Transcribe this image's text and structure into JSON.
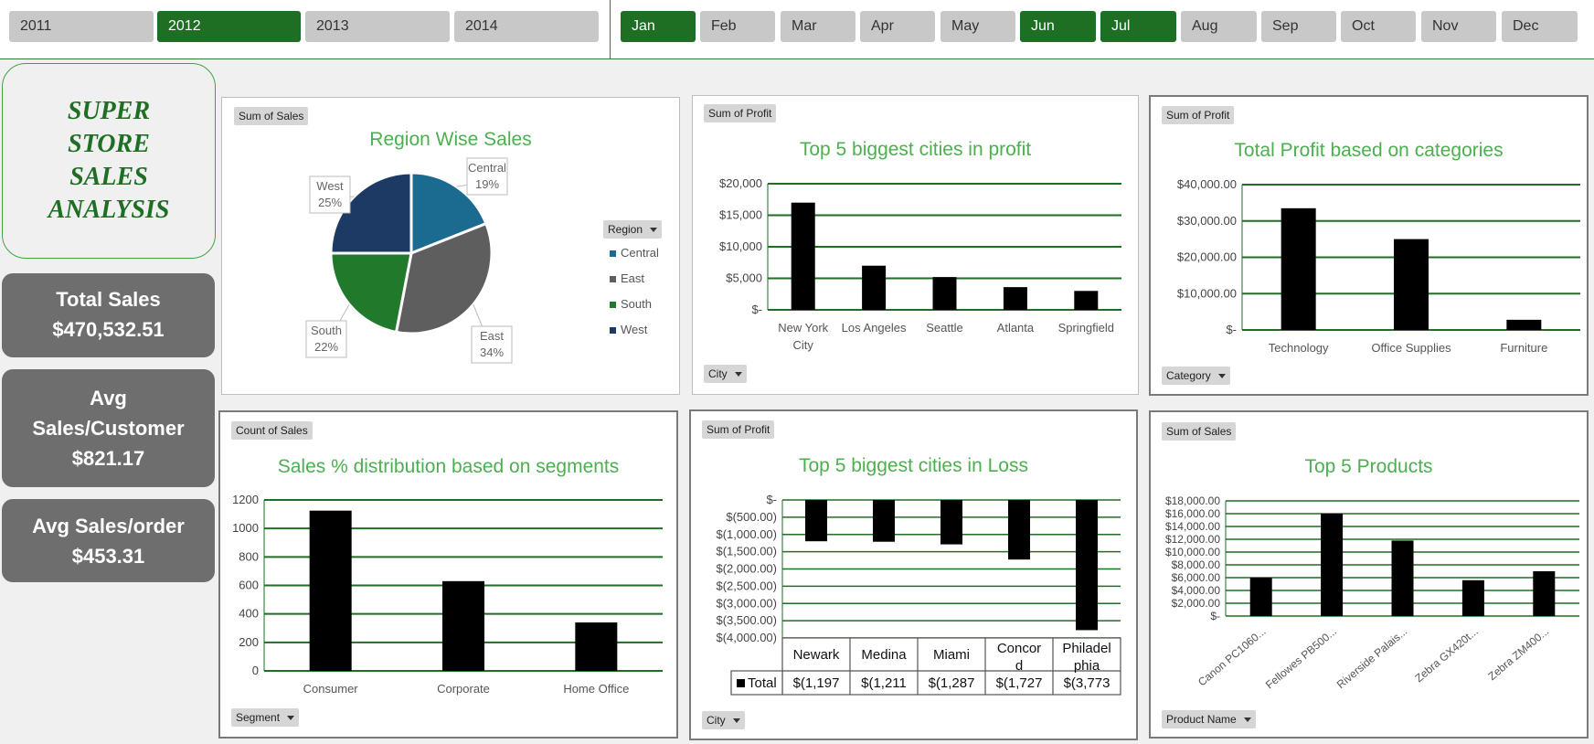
{
  "years": {
    "items": [
      {
        "label": "2011",
        "selected": false
      },
      {
        "label": "2012",
        "selected": true
      },
      {
        "label": "2013",
        "selected": false
      },
      {
        "label": "2014",
        "selected": false
      }
    ]
  },
  "months": {
    "items": [
      {
        "label": "Jan",
        "selected": true
      },
      {
        "label": "Feb",
        "selected": false
      },
      {
        "label": "Mar",
        "selected": false
      },
      {
        "label": "Apr",
        "selected": false
      },
      {
        "label": "May",
        "selected": false
      },
      {
        "label": "Jun",
        "selected": true
      },
      {
        "label": "Jul",
        "selected": true
      },
      {
        "label": "Aug",
        "selected": false
      },
      {
        "label": "Sep",
        "selected": false
      },
      {
        "label": "Oct",
        "selected": false
      },
      {
        "label": "Nov",
        "selected": false
      },
      {
        "label": "Dec",
        "selected": false
      }
    ]
  },
  "dashboard_title": "SUPER\nSTORE\nSALES\nANALYSIS",
  "kpis": {
    "total_sales": {
      "label": "Total Sales",
      "value": "$470,532.51"
    },
    "avg_sales_customer": {
      "label": "Avg\nSales/Customer",
      "value": "$821.17"
    },
    "avg_sales_order": {
      "label": "Avg Sales/order",
      "value": "$453.31"
    }
  },
  "colors": {
    "selected_green": "#1e6e24",
    "title_green": "#4caf50",
    "gridline_green": "#1e6e24",
    "bar_black": "#000000",
    "central": "#1b6a8f",
    "east": "#5e5e5e",
    "south": "#217a2c",
    "west": "#1c3a63"
  },
  "panels": {
    "region": {
      "field": "Sum of Sales",
      "title": "Region Wise Sales",
      "legend_title": "Region"
    },
    "profit_cities": {
      "field": "Sum of Profit",
      "title": "Top 5 biggest cities in profit",
      "filter": "City"
    },
    "profit_categories": {
      "field": "Sum of Profit",
      "title": "Total Profit based on categories",
      "filter": "Category"
    },
    "segments": {
      "field": "Count of Sales",
      "title": "Sales % distribution based on segments",
      "filter": "Segment"
    },
    "loss_cities": {
      "field": "Sum of Profit",
      "title": "Top 5 biggest cities in Loss",
      "filter": "City",
      "total_label": "Total"
    },
    "products": {
      "field": "Sum of Sales",
      "title": "Top 5 Products",
      "filter": "Product Name"
    }
  },
  "chart_data": [
    {
      "id": "region",
      "type": "pie",
      "title": "Region Wise Sales",
      "legend_title": "Region",
      "legend_position": "right",
      "slices": [
        {
          "name": "Central",
          "value": 19,
          "label": "19%"
        },
        {
          "name": "East",
          "value": 34,
          "label": "34%"
        },
        {
          "name": "South",
          "value": 22,
          "label": "22%"
        },
        {
          "name": "West",
          "value": 25,
          "label": "25%"
        }
      ]
    },
    {
      "id": "profit_cities",
      "type": "bar",
      "title": "Top 5 biggest cities in profit",
      "categories": [
        "New York\nCity",
        "Los Angeles",
        "Seattle",
        "Atlanta",
        "Springfield"
      ],
      "values": [
        17000,
        7000,
        5200,
        3600,
        3000
      ],
      "ylim": [
        0,
        20000
      ],
      "yticks": [
        0,
        5000,
        10000,
        15000,
        20000
      ],
      "ytick_labels": [
        "$-",
        "$5,000",
        "$10,000",
        "$15,000",
        "$20,000"
      ],
      "grid": true
    },
    {
      "id": "profit_categories",
      "type": "bar",
      "title": "Total Profit based on categories",
      "categories": [
        "Technology",
        "Office Supplies",
        "Furniture"
      ],
      "values": [
        33500,
        25000,
        2800
      ],
      "ylim": [
        0,
        40000
      ],
      "yticks": [
        0,
        10000,
        20000,
        30000,
        40000
      ],
      "ytick_labels": [
        "$-",
        "$10,000.00",
        "$20,000.00",
        "$30,000.00",
        "$40,000.00"
      ],
      "grid": true
    },
    {
      "id": "segments",
      "type": "bar",
      "title": "Sales % distribution based on segments",
      "categories": [
        "Consumer",
        "Corporate",
        "Home Office"
      ],
      "values": [
        1125,
        630,
        340
      ],
      "ylim": [
        0,
        1200
      ],
      "yticks": [
        0,
        200,
        400,
        600,
        800,
        1000,
        1200
      ],
      "ytick_labels": [
        "0",
        "200",
        "400",
        "600",
        "800",
        "1000",
        "1200"
      ],
      "grid": true
    },
    {
      "id": "loss_cities",
      "type": "bar",
      "title": "Top 5 biggest cities in Loss",
      "categories": [
        "Newark",
        "Medina",
        "Miami",
        "Concord",
        "Philadelphia"
      ],
      "category_display": [
        "Newark",
        "Medina",
        "Miami",
        "Concor\nd",
        "Philadel\nphia"
      ],
      "values": [
        -1197,
        -1211,
        -1287,
        -1727,
        -3773
      ],
      "value_labels": [
        "$(1,197",
        "$(1,211",
        "$(1,287",
        "$(1,727",
        "$(3,773"
      ],
      "ylim": [
        -4000,
        0
      ],
      "yticks": [
        0,
        -500,
        -1000,
        -1500,
        -2000,
        -2500,
        -3000,
        -3500,
        -4000
      ],
      "ytick_labels": [
        "$-",
        "$(500.00)",
        "$(1,000.00)",
        "$(1,500.00)",
        "$(2,000.00)",
        "$(2,500.00)",
        "$(3,000.00)",
        "$(3,500.00)",
        "$(4,000.00)"
      ],
      "grid": true
    },
    {
      "id": "products",
      "type": "bar",
      "title": "Top 5 Products",
      "categories": [
        "Canon PC1060...",
        "Fellowes PB500...",
        "Riverside Palais...",
        "Zebra GX420t...",
        "Zebra ZM400..."
      ],
      "values": [
        6000,
        16000,
        11800,
        5600,
        7000
      ],
      "ylim": [
        0,
        18000
      ],
      "yticks": [
        0,
        2000,
        4000,
        6000,
        8000,
        10000,
        12000,
        14000,
        16000,
        18000
      ],
      "ytick_labels": [
        "$-",
        "$2,000.00",
        "$4,000.00",
        "$6,000.00",
        "$8,000.00",
        "$10,000.00",
        "$12,000.00",
        "$14,000.00",
        "$16,000.00",
        "$18,000.00"
      ],
      "grid": true
    }
  ]
}
